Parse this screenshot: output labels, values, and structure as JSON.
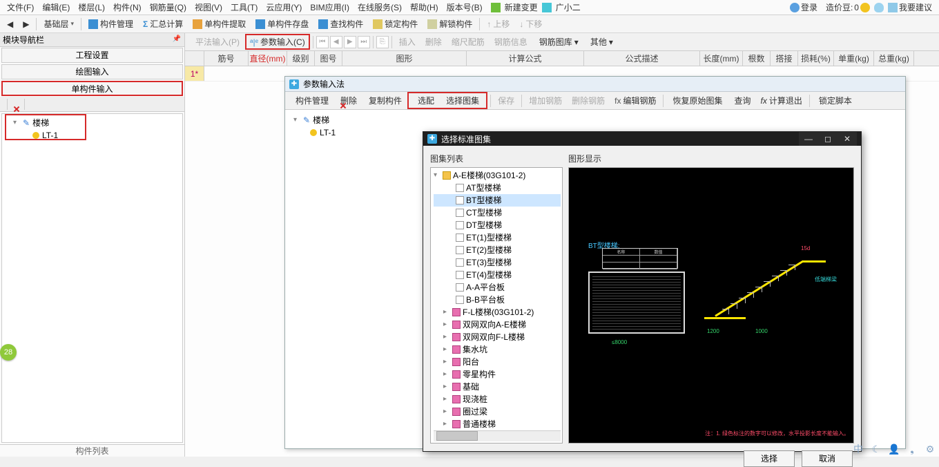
{
  "menubar": {
    "items": [
      "文件(F)",
      "编辑(E)",
      "楼层(L)",
      "构件(N)",
      "钢筋量(Q)",
      "视图(V)",
      "工具(T)",
      "云应用(Y)",
      "BIM应用(I)",
      "在线服务(S)",
      "帮助(H)",
      "版本号(B)"
    ],
    "new_change": "新建变更",
    "gxe": "广小二",
    "login": "登录",
    "price_beans_label": "造价豆:",
    "price_beans_value": "0",
    "suggest": "我要建议"
  },
  "toolbar1": {
    "base_layer": "基础层",
    "items": [
      "构件管理",
      "汇总计算",
      "单构件提取",
      "单构件存盘",
      "查找构件",
      "锁定构件",
      "解锁构件"
    ],
    "up": "上移",
    "down": "下移"
  },
  "left": {
    "nav_title": "模块导航栏",
    "tabs": [
      "工程设置",
      "绘图输入",
      "单构件输入"
    ],
    "tree_root": "楼梯",
    "tree_child": "LT-1",
    "footer": "构件列表"
  },
  "right_tb": {
    "pingfa": "平法输入(P)",
    "param": "参数输入(C)",
    "insert": "插入",
    "delete": "删除",
    "scale": "缩尺配筋",
    "rebar_info": "钢筋信息",
    "rebar_lib": "钢筋图库",
    "other": "其他"
  },
  "grid": {
    "cols": [
      "筋号",
      "直径(mm)",
      "级别",
      "图号",
      "图形",
      "计算公式",
      "公式描述",
      "长度(mm)",
      "根数",
      "搭接",
      "损耗(%)",
      "单重(kg)",
      "总重(kg)"
    ],
    "row1_num": "1*"
  },
  "badge": "28",
  "param_window": {
    "title": "参数输入法",
    "toolbar": {
      "manage": "构件管理",
      "delete": "删除",
      "copy": "复制构件",
      "match": "选配",
      "select_atlas": "选择图集",
      "save": "保存",
      "add_rebar": "增加钢筋",
      "del_rebar": "删除钢筋",
      "edit_rebar": "编辑钢筋",
      "restore": "恢复原始图集",
      "query": "查询",
      "calc_exit": "计算退出",
      "lock_script": "锁定脚本"
    },
    "tree_root": "楼梯",
    "tree_child": "LT-1"
  },
  "select_dialog": {
    "title": "选择标准图集",
    "list_label": "图集列表",
    "preview_label": "图形显示",
    "root": "A-E楼梯(03G101-2)",
    "leaves": [
      "AT型楼梯",
      "BT型楼梯",
      "CT型楼梯",
      "DT型楼梯",
      "ET(1)型楼梯",
      "ET(2)型楼梯",
      "ET(3)型楼梯",
      "ET(4)型楼梯",
      "A-A平台板",
      "B-B平台板"
    ],
    "groups": [
      "F-L楼梯(03G101-2)",
      "双网双向A-E楼梯",
      "双网双向F-L楼梯",
      "集水坑",
      "阳台",
      "零星构件",
      "基础",
      "现浇桩",
      "圈过梁",
      "普通楼梯"
    ],
    "btn_ok": "选择",
    "btn_cancel": "取消",
    "preview": {
      "bt_label": "BT型楼梯:",
      "note": "注：1. 绿色标注的数字可以修改，水平投影长度不能输入。"
    }
  }
}
